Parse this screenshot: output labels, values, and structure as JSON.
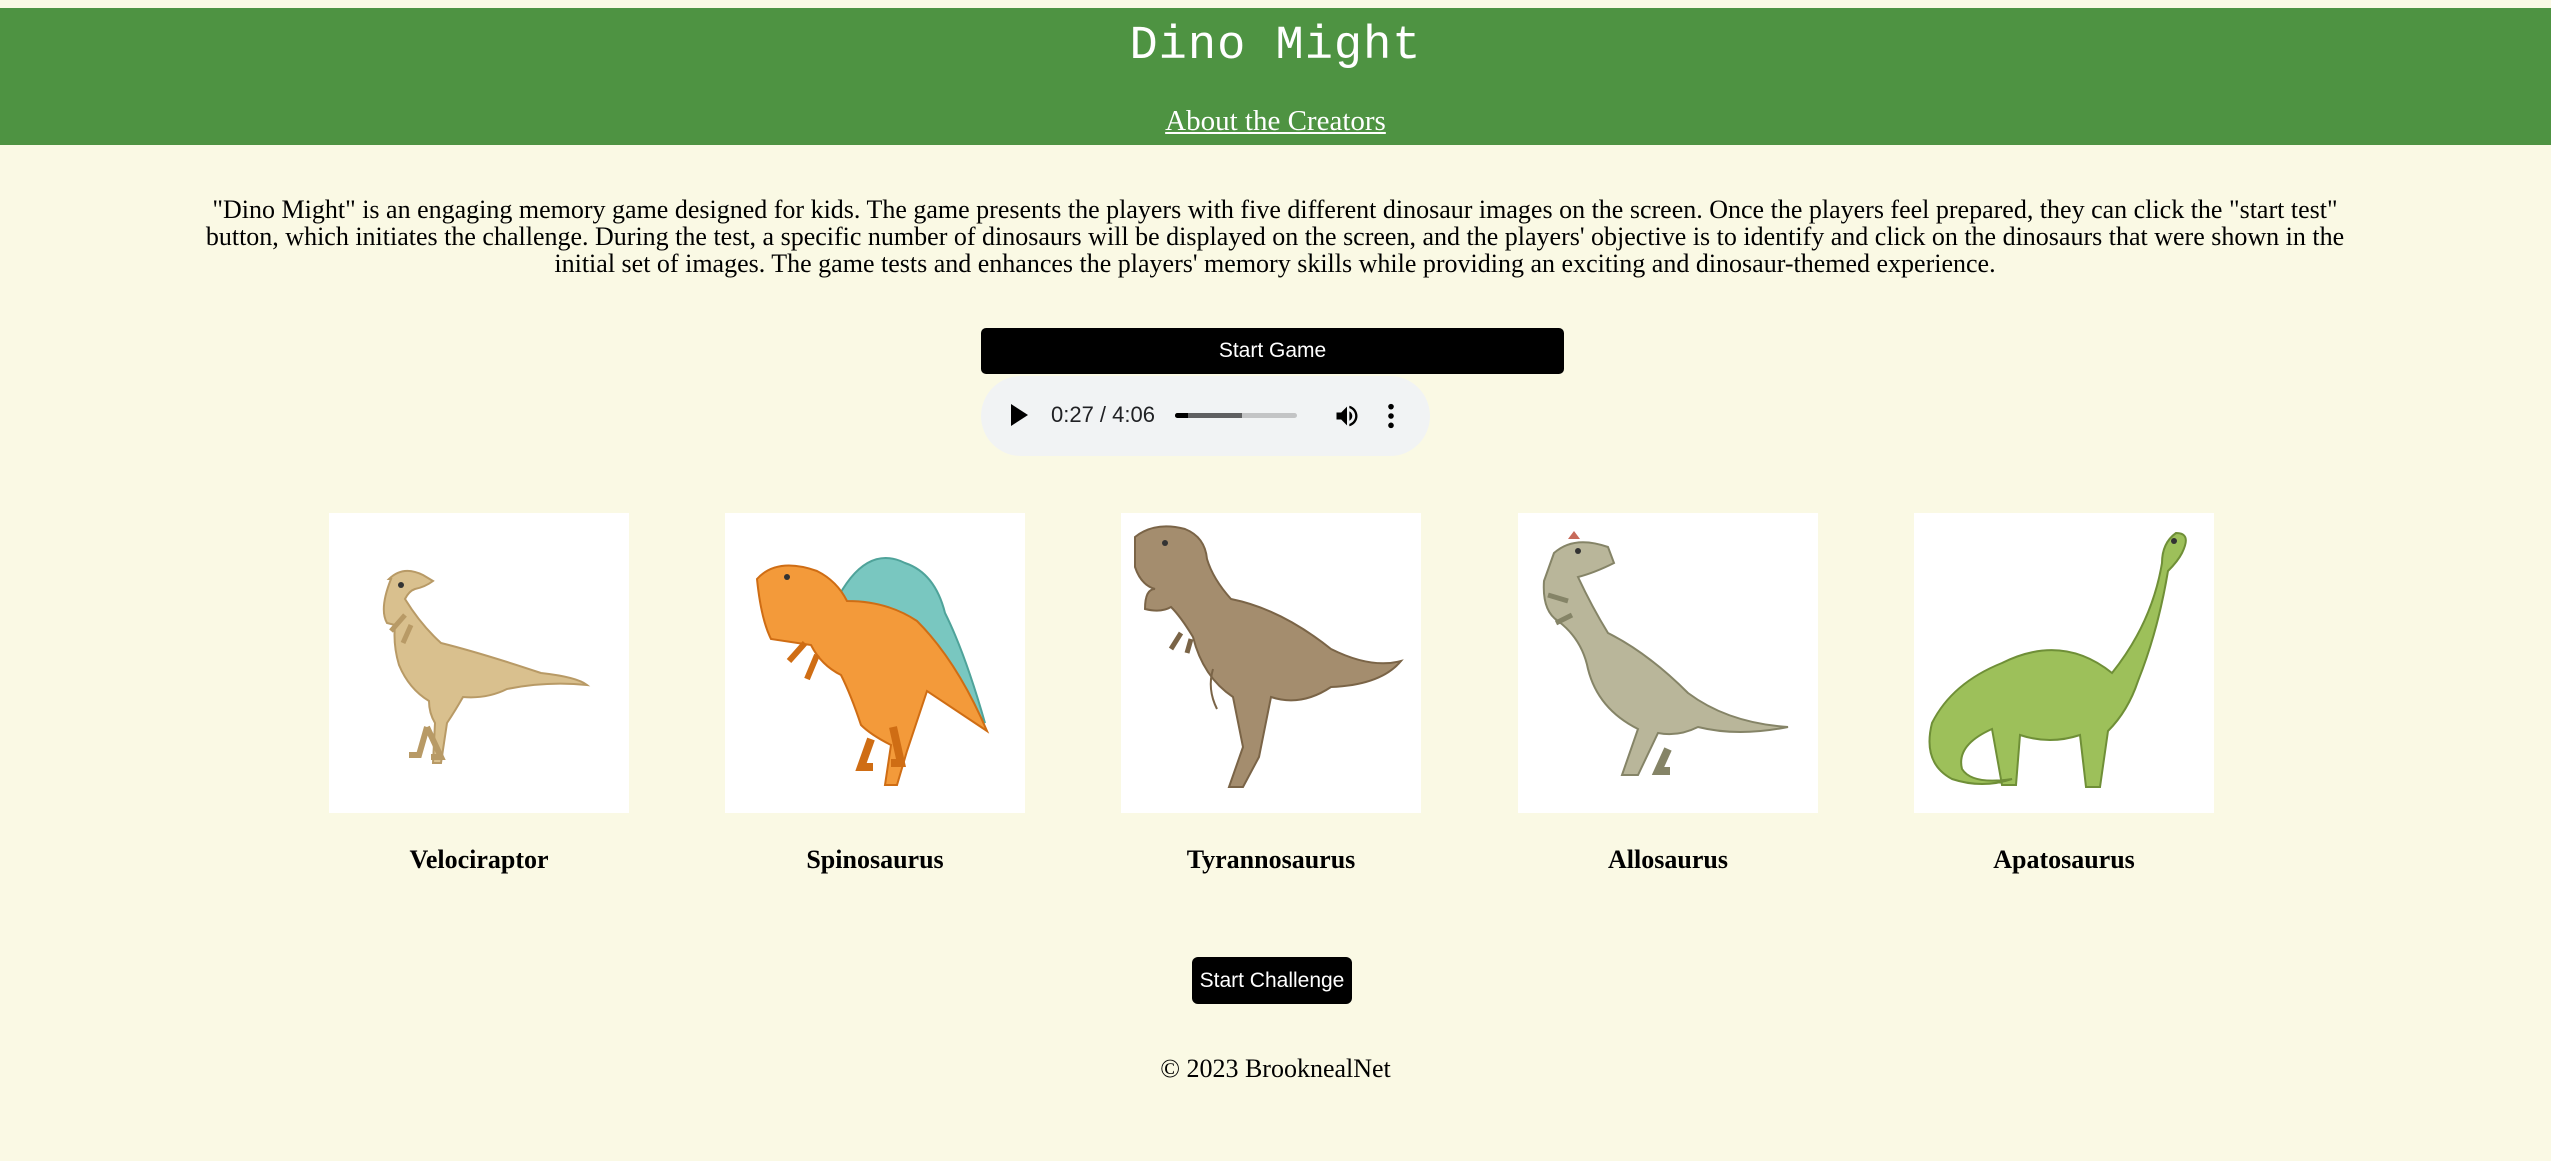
{
  "header": {
    "title": "Dino Might",
    "about_link": "About the Creators"
  },
  "description": "\"Dino Might\" is an engaging memory game designed for kids. The game presents the players with five different dinosaur images on the screen. Once the players feel prepared, they can click the \"start test\" button, which initiates the challenge. During the test, a specific number of dinosaurs will be displayed on the screen, and the players' objective is to identify and click on the dinosaurs that were shown in the initial set of images. The game tests and enhances the players' memory skills while providing an exciting and dinosaur-themed experience.",
  "controls": {
    "start_game_label": "Start Game",
    "start_challenge_label": "Start Challenge"
  },
  "audio_player": {
    "time_display": "0:27 / 4:06",
    "played_fraction": 0.11,
    "buffered_fraction": 0.55,
    "icons": [
      "play-icon",
      "volume-icon",
      "more-options-icon"
    ]
  },
  "dinosaurs": [
    {
      "name": "Velociraptor",
      "color": "#d9c08e"
    },
    {
      "name": "Spinosaurus",
      "color": "#f39a3a"
    },
    {
      "name": "Tyrannosaurus",
      "color": "#a48d6e"
    },
    {
      "name": "Allosaurus",
      "color": "#b9b69a"
    },
    {
      "name": "Apatosaurus",
      "color": "#9dc05a"
    }
  ],
  "footer": {
    "copyright": "© 2023 BrooknealNet"
  },
  "colors": {
    "header_bg": "#4e9342",
    "page_bg": "#faf9e4",
    "button_bg": "#000000"
  }
}
